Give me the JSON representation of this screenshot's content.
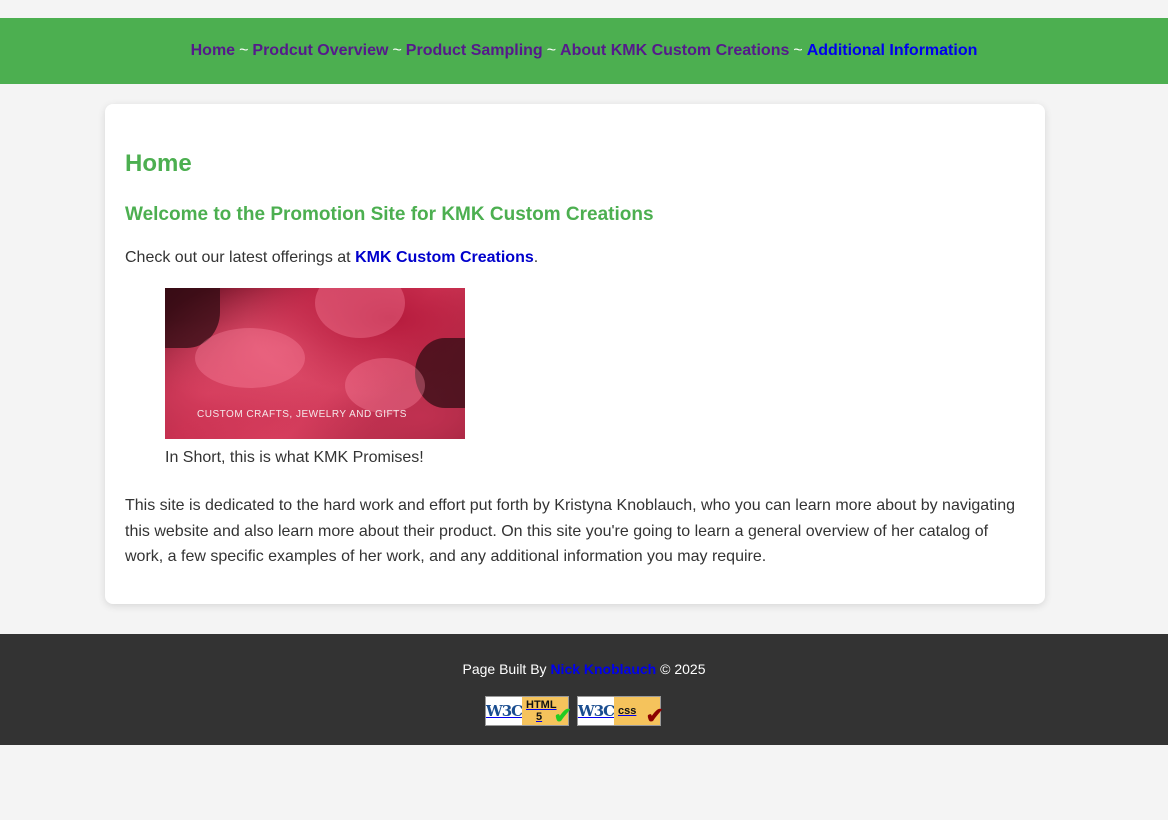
{
  "nav": {
    "items": [
      {
        "label": "Home"
      },
      {
        "label": "Prodcut Overview"
      },
      {
        "label": "Product Sampling"
      },
      {
        "label": "About KMK Custom Creations"
      },
      {
        "label": "Additional Information"
      }
    ],
    "separator": "~",
    "colors": {
      "bar": "#4caf50",
      "visited_link": "#551a8b",
      "active_link": "#0000ee"
    }
  },
  "main": {
    "title": "Home",
    "subtitle": "Welcome to the Promotion Site for KMK Custom Creations",
    "intro_text": "Check out our latest offerings at ",
    "intro_link": "KMK Custom Creations",
    "intro_end": ".",
    "figure": {
      "image_text": "CUSTOM CRAFTS, JEWELRY AND GIFTS",
      "caption": "In Short, this is what KMK Promises!"
    },
    "body": "This site is dedicated to the hard work and effort put forth by Kristyna Knoblauch, who you can learn more about by navigating this website and also learn more about their product. On this site you're going to learn a general overview of her catalog of work, a few specific examples of her work, and any additional information you may require."
  },
  "footer": {
    "credit_prefix": "Page Built By ",
    "credit_link": "Nick Knoblauch",
    "credit_suffix": " © 2025",
    "badges": [
      {
        "logo": "W3C",
        "label_line1": "HTML",
        "label_line2": "5",
        "tick": "✔",
        "tick_color": "#22cc22"
      },
      {
        "logo": "W3C",
        "label_line1": "css",
        "label_line2": "",
        "tick": "✔",
        "tick_color": "#8b0000"
      }
    ]
  }
}
